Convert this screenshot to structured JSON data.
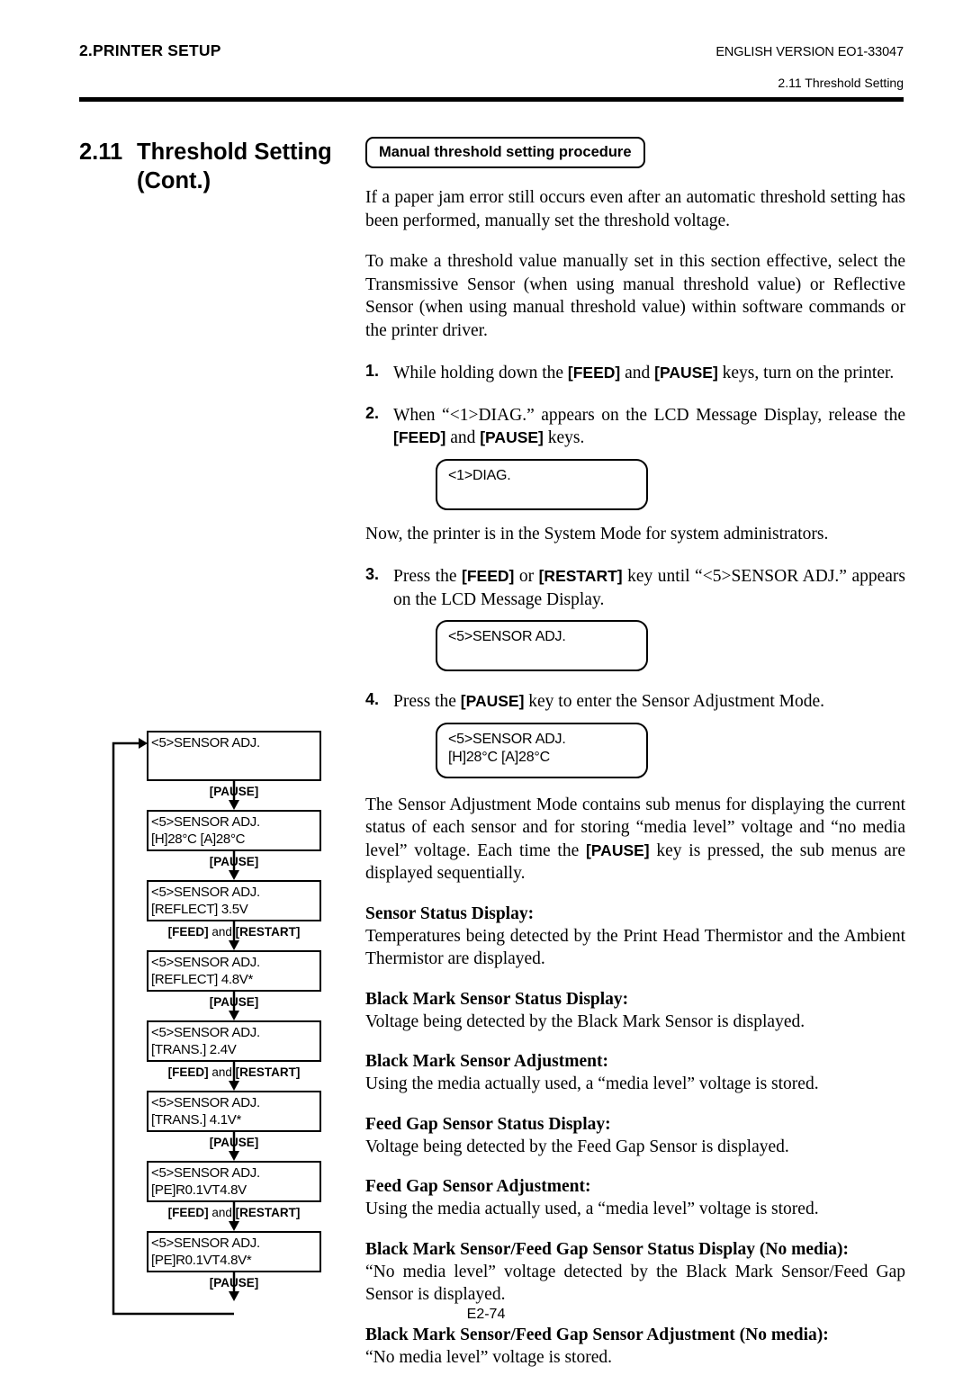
{
  "header": {
    "left": "2.PRINTER SETUP",
    "right": "ENGLISH VERSION EO1-33047",
    "sub": "2.11 Threshold Setting"
  },
  "section": {
    "number": "2.11",
    "title": "Threshold Setting",
    "cont": "(Cont.)"
  },
  "procedure_box": {
    "label": "Manual threshold setting procedure"
  },
  "intro": {
    "p1": "If a paper jam error still occurs even after an automatic threshold setting has been performed, manually set the threshold voltage.",
    "p2": "To make a threshold value manually set in this section effective, select the Transmissive Sensor (when using manual threshold value) or Reflective Sensor (when using manual threshold value) within software commands or the printer driver."
  },
  "steps": [
    {
      "marker": "1.",
      "parts": [
        {
          "t": "While holding down the ",
          "k": false
        },
        {
          "t": "[FEED]",
          "k": true
        },
        {
          "t": " and ",
          "k": false
        },
        {
          "t": "[PAUSE]",
          "k": true
        },
        {
          "t": " keys, turn on the printer.",
          "k": false
        }
      ]
    },
    {
      "marker": "2.",
      "parts": [
        {
          "t": "When “<1>DIAG.” appears on the LCD Message Display, release the ",
          "k": false
        },
        {
          "t": "[FEED]",
          "k": true
        },
        {
          "t": " and ",
          "k": false
        },
        {
          "t": "[PAUSE]",
          "k": true
        },
        {
          "t": " keys.",
          "k": false
        }
      ]
    },
    {
      "marker": "3.",
      "parts": [
        {
          "t": "Press the ",
          "k": false
        },
        {
          "t": "[FEED]",
          "k": true
        },
        {
          "t": " or ",
          "k": false
        },
        {
          "t": "[RESTART]",
          "k": true
        },
        {
          "t": " key until “<5>SENSOR ADJ.” appears on the LCD Message Display.",
          "k": false
        }
      ]
    },
    {
      "marker": "4.",
      "parts": [
        {
          "t": "Press the ",
          "k": false
        },
        {
          "t": "[PAUSE]",
          "k": true
        },
        {
          "t": " key to enter the Sensor Adjustment Mode.",
          "k": false
        }
      ]
    }
  ],
  "lcd": {
    "diag": [
      "<1>DIAG."
    ],
    "sensor_adj": [
      "<5>SENSOR ADJ."
    ],
    "sensor_adj_temp": [
      "<5>SENSOR ADJ.",
      "[H]28°C  [A]28°C"
    ]
  },
  "note_system_mode": "Now, the printer is in the System Mode for system administrators.",
  "mode_description": {
    "parts": [
      {
        "t": "The Sensor Adjustment Mode contains sub menus for displaying the current status of each sensor and for storing “media level” voltage and “no media level” voltage.  Each time the ",
        "k": false
      },
      {
        "t": "[PAUSE]",
        "k": true
      },
      {
        "t": " key is pressed, the sub menus are displayed sequentially.",
        "k": false
      }
    ]
  },
  "subsections": [
    {
      "heading": "Sensor Status Display:",
      "text": "Temperatures being detected by the Print Head Thermistor and the Ambient Thermistor are displayed."
    },
    {
      "heading": "Black Mark Sensor Status Display:",
      "text": "Voltage being detected by the Black Mark Sensor is displayed."
    },
    {
      "heading": "Black Mark Sensor Adjustment:",
      "text": "Using the media actually used, a “media level” voltage is stored."
    },
    {
      "heading": "Feed Gap Sensor Status Display:",
      "text": "Voltage being detected by the Feed Gap Sensor is displayed."
    },
    {
      "heading": "Feed Gap Sensor Adjustment:",
      "text": "Using the media actually used, a “media level” voltage is stored."
    },
    {
      "heading": "Black Mark Sensor/Feed Gap Sensor Status Display (No media):",
      "text": "“No media level” voltage detected by the Black Mark Sensor/Feed Gap Sensor is displayed."
    },
    {
      "heading": "Black Mark Sensor/Feed Gap Sensor Adjustment (No media):",
      "text": "“No media level” voltage is stored."
    }
  ],
  "flowchart": {
    "boxes": [
      {
        "line1": "<5>SENSOR ADJ.",
        "line2": "",
        "tall": true
      },
      {
        "line1": "<5>SENSOR ADJ.",
        "line2": "[H]28°C  [A]28°C",
        "tall": false
      },
      {
        "line1": "<5>SENSOR ADJ.",
        "line2": "[REFLECT] 3.5V",
        "tall": false
      },
      {
        "line1": "<5>SENSOR ADJ.",
        "line2": "[REFLECT] 4.8V*",
        "tall": false
      },
      {
        "line1": "<5>SENSOR ADJ.",
        "line2": "[TRANS.] 2.4V",
        "tall": false
      },
      {
        "line1": "<5>SENSOR ADJ.",
        "line2": "[TRANS.] 4.1V*",
        "tall": false
      },
      {
        "line1": "<5>SENSOR ADJ.",
        "line2": "[PE]R0.1VT4.8V",
        "tall": false
      },
      {
        "line1": "<5>SENSOR ADJ.",
        "line2": "[PE]R0.1VT4.8V*",
        "tall": false
      }
    ],
    "transitions": [
      {
        "key1": "[PAUSE]",
        "joiner": "",
        "key2": ""
      },
      {
        "key1": "[PAUSE]",
        "joiner": "",
        "key2": ""
      },
      {
        "key1": "[FEED]",
        "joiner": " and ",
        "key2": "[RESTART]"
      },
      {
        "key1": "[PAUSE]",
        "joiner": "",
        "key2": ""
      },
      {
        "key1": "[FEED]",
        "joiner": " and ",
        "key2": "[RESTART]"
      },
      {
        "key1": "[PAUSE]",
        "joiner": "",
        "key2": ""
      },
      {
        "key1": "[FEED]",
        "joiner": " and ",
        "key2": "[RESTART]"
      },
      {
        "key1": "[PAUSE]",
        "joiner": "",
        "key2": ""
      }
    ]
  },
  "footer": {
    "page": "E2-74"
  }
}
